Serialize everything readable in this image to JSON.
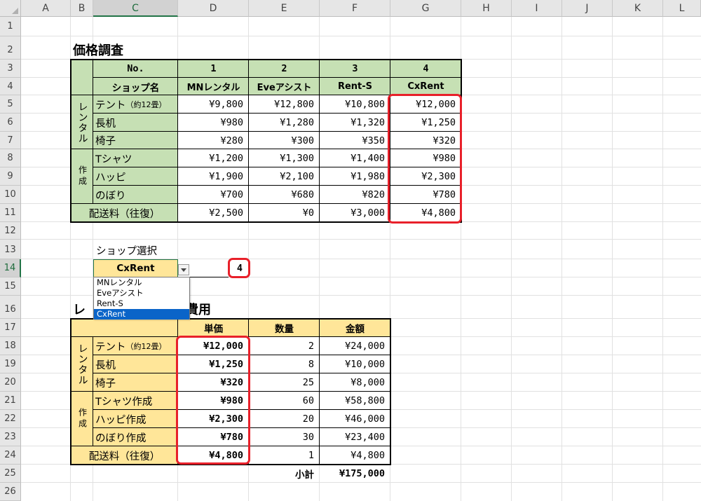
{
  "columns": [
    "A",
    "B",
    "C",
    "D",
    "E",
    "F",
    "G",
    "H",
    "I",
    "J",
    "K",
    "L"
  ],
  "rows": [
    "1",
    "2",
    "3",
    "4",
    "5",
    "6",
    "7",
    "8",
    "9",
    "10",
    "11",
    "12",
    "13",
    "14",
    "15",
    "16",
    "17",
    "18",
    "19",
    "20",
    "21",
    "22",
    "23",
    "24",
    "25",
    "26"
  ],
  "price_survey": {
    "title": "価格調査",
    "no_label": "No.",
    "shop_label": "ショップ名",
    "shop_numbers": [
      "1",
      "2",
      "3",
      "4"
    ],
    "shop_names": [
      "MNレンタル",
      "Eveアシスト",
      "Rent-S",
      "CxRent"
    ],
    "group_rental": "レンタル",
    "group_make": "作成",
    "rows": [
      {
        "item": "テント",
        "note": "（約12畳）",
        "prices": [
          "¥9,800",
          "¥12,800",
          "¥10,800",
          "¥12,000"
        ]
      },
      {
        "item": "長机",
        "prices": [
          "¥980",
          "¥1,280",
          "¥1,320",
          "¥1,250"
        ]
      },
      {
        "item": "椅子",
        "prices": [
          "¥280",
          "¥300",
          "¥350",
          "¥320"
        ]
      },
      {
        "item": "Tシャツ",
        "prices": [
          "¥1,200",
          "¥1,300",
          "¥1,400",
          "¥980"
        ]
      },
      {
        "item": "ハッピ",
        "prices": [
          "¥1,900",
          "¥2,100",
          "¥1,980",
          "¥2,300"
        ]
      },
      {
        "item": "のぼり",
        "prices": [
          "¥700",
          "¥680",
          "¥820",
          "¥780"
        ]
      },
      {
        "item": "配送料（往復）",
        "prices": [
          "¥2,500",
          "¥0",
          "¥3,000",
          "¥4,800"
        ]
      }
    ]
  },
  "shop_select": {
    "label": "ショップ選択",
    "selected": "CxRent",
    "index": "4",
    "options": [
      "MNレンタル",
      "Eveアシスト",
      "Rent-S",
      "CxRent"
    ]
  },
  "cost_table": {
    "title_left": "レ",
    "title_right": "費用",
    "headers": {
      "unit_price": "単価",
      "quantity": "数量",
      "amount": "金額"
    },
    "group_rental": "レンタル",
    "group_make": "作成",
    "rows": [
      {
        "item": "テント",
        "note": "（約12畳）",
        "unit_price": "¥12,000",
        "quantity": "2",
        "amount": "¥24,000"
      },
      {
        "item": "長机",
        "unit_price": "¥1,250",
        "quantity": "8",
        "amount": "¥10,000"
      },
      {
        "item": "椅子",
        "unit_price": "¥320",
        "quantity": "25",
        "amount": "¥8,000"
      },
      {
        "item": "Tシャツ作成",
        "unit_price": "¥980",
        "quantity": "60",
        "amount": "¥58,800"
      },
      {
        "item": "ハッピ作成",
        "unit_price": "¥2,300",
        "quantity": "20",
        "amount": "¥46,000"
      },
      {
        "item": "のぼり作成",
        "unit_price": "¥780",
        "quantity": "30",
        "amount": "¥23,400"
      },
      {
        "item": "配送料（往復）",
        "unit_price": "¥4,800",
        "quantity": "1",
        "amount": "¥4,800"
      }
    ],
    "subtotal_label": "小計",
    "subtotal_value": "¥175,000"
  },
  "colors": {
    "green_header": "#c6e0b4",
    "yellow_header": "#ffe699",
    "highlight_red": "#e8202a",
    "selected_option": "#0a64c8"
  }
}
